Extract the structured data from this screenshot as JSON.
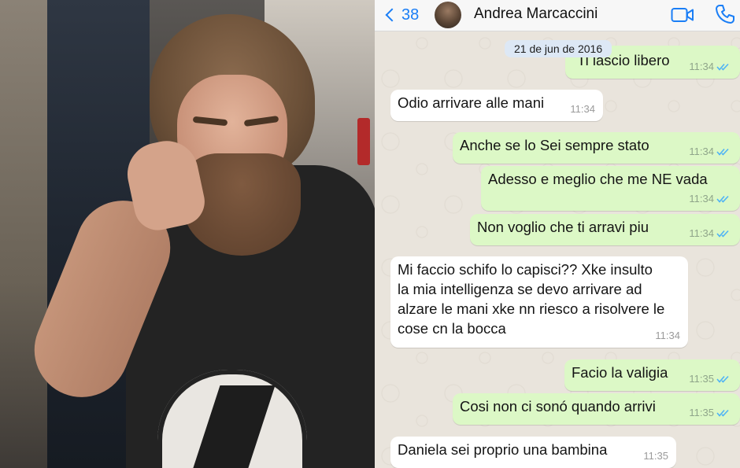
{
  "header": {
    "back_count": "38",
    "contact_name": "Andrea Marcaccini"
  },
  "icons": {
    "back": "chevron-left-icon",
    "avatar": "avatar",
    "video": "video-call-icon",
    "phone": "phone-call-icon",
    "read_receipt": "double-check-icon"
  },
  "colors": {
    "accent": "#1a7ef6",
    "outgoing_bubble": "#dcf8c6",
    "incoming_bubble": "#ffffff",
    "date_pill": "#dde8f5",
    "read_ticks": "#4fb3f5"
  },
  "date_separator": "21 de jun de 2016",
  "messages": [
    {
      "direction": "out",
      "text": "Ti lascio libero",
      "time": "11:34",
      "read": true
    },
    {
      "direction": "in",
      "text": "Odio arrivare alle mani",
      "time": "11:34"
    },
    {
      "direction": "out",
      "text": "Anche se lo Sei sempre stato",
      "time": "11:34",
      "read": true
    },
    {
      "direction": "out",
      "text": "Adesso e meglio che me NE vada",
      "time": "11:34",
      "read": true
    },
    {
      "direction": "out",
      "text": "Non voglio che ti arravi piu",
      "time": "11:34",
      "read": true
    },
    {
      "direction": "in",
      "lines": [
        "Mi faccio schifo lo capisci?? Xke insulto",
        "la mia intelligenza se devo arrivare ad",
        "alzare le mani xke nn riesco a risolvere le",
        "cose cn la bocca"
      ],
      "time": "11:34"
    },
    {
      "direction": "out",
      "text": "Facio la valigia",
      "time": "11:35",
      "read": true
    },
    {
      "direction": "out",
      "text": "Cosi non ci sonó quando arrivi",
      "time": "11:35",
      "read": true
    },
    {
      "direction": "in",
      "text": "Daniela sei proprio una bambina",
      "time": "11:35"
    }
  ]
}
